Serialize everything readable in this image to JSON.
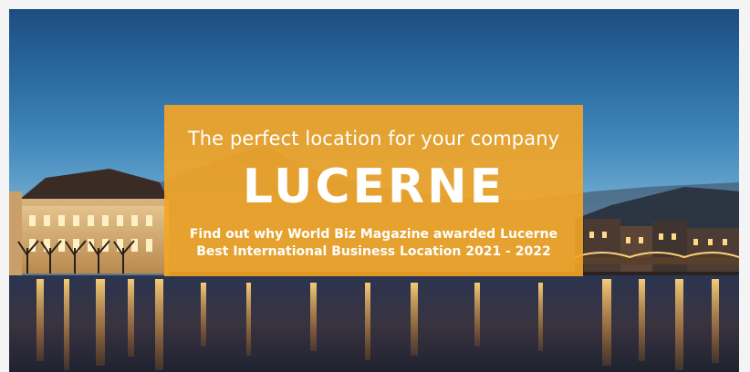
{
  "hero": {
    "tagline": "The perfect location for your company",
    "headline": "LUCERNE",
    "award_line_1": "Find out why World Biz Magazine awarded Lucerne",
    "award_line_2": "Best International Business Location 2021 - 2022",
    "background_image": "lucerne-night-waterfront-photo",
    "banner_color": "#F5A523"
  }
}
